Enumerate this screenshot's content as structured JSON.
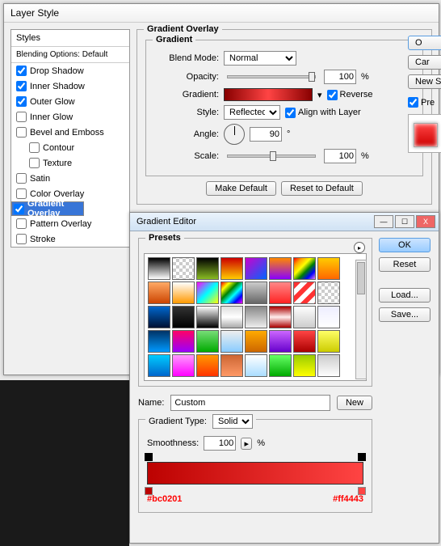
{
  "layerStyle": {
    "title": "Layer Style",
    "stylesHeader": "Styles",
    "blendingOptions": "Blending Options: Default",
    "items": [
      {
        "label": "Drop Shadow",
        "checked": true
      },
      {
        "label": "Inner Shadow",
        "checked": true
      },
      {
        "label": "Outer Glow",
        "checked": true
      },
      {
        "label": "Inner Glow",
        "checked": false
      },
      {
        "label": "Bevel and Emboss",
        "checked": false
      },
      {
        "label": "Contour",
        "checked": false,
        "sub": true
      },
      {
        "label": "Texture",
        "checked": false,
        "sub": true
      },
      {
        "label": "Satin",
        "checked": false
      },
      {
        "label": "Color Overlay",
        "checked": false
      },
      {
        "label": "Gradient Overlay",
        "checked": true,
        "selected": true
      },
      {
        "label": "Pattern Overlay",
        "checked": false
      },
      {
        "label": "Stroke",
        "checked": false
      }
    ],
    "panel": {
      "title": "Gradient Overlay",
      "subTitle": "Gradient",
      "blendModeLabel": "Blend Mode:",
      "blendMode": "Normal",
      "opacityLabel": "Opacity:",
      "opacity": "100",
      "pct": "%",
      "gradientLabel": "Gradient:",
      "reverseLabel": "Reverse",
      "reverse": true,
      "styleLabel": "Style:",
      "style": "Reflected",
      "alignLabel": "Align with Layer",
      "align": true,
      "angleLabel": "Angle:",
      "angle": "90",
      "deg": "°",
      "scaleLabel": "Scale:",
      "scale": "100",
      "makeDefault": "Make Default",
      "resetDefault": "Reset to Default"
    },
    "right": {
      "ok": "O",
      "cancel": "Car",
      "newStyle": "New S",
      "previewLabel": "Pre",
      "preview": true
    }
  },
  "gradientEditor": {
    "title": "Gradient Editor",
    "presetsLabel": "Presets",
    "ok": "OK",
    "reset": "Reset",
    "load": "Load...",
    "save": "Save...",
    "nameLabel": "Name:",
    "name": "Custom",
    "new": "New",
    "gradientTypeLabel": "Gradient Type:",
    "gradientType": "Solid",
    "smoothnessLabel": "Smoothness:",
    "smoothness": "100",
    "pct": "%",
    "hexLeft": "#bc0201",
    "hexRight": "#ff4443",
    "swatches": [
      "linear-gradient(#000,#fff)",
      "repeating-conic-gradient(#ccc 0 25%,#fff 0 50%) 0/8px 8px",
      "linear-gradient(#000,#8b2)",
      "linear-gradient(#c00,#fc0)",
      "linear-gradient(135deg,#c0c,#06f)",
      "linear-gradient(#f80,#80f)",
      "linear-gradient(135deg,red,orange,yellow,green,blue,violet)",
      "linear-gradient(#fc0,#f60)",
      "linear-gradient(#fa6,#c40)",
      "linear-gradient(#fff,#f90)",
      "linear-gradient(135deg,#f0f,#0ff,#ff0)",
      "linear-gradient(135deg,red,yellow,green,cyan,blue,magenta)",
      "linear-gradient(#ccc,#666)",
      "linear-gradient(#f88,#f22)",
      "repeating-linear-gradient(135deg,#f33 0 6px,#fff 6px 12px)",
      "repeating-conic-gradient(#ccc 0 25%,#fff 0 50%) 0/8px 8px",
      "linear-gradient(#06c,#013)",
      "linear-gradient(#333,#000)",
      "linear-gradient(#fff,#000)",
      "linear-gradient(#ddd,#fff,#aaa)",
      "linear-gradient(#888,#eee)",
      "linear-gradient(#a00,#fee,#a00)",
      "linear-gradient(#fff,#ccc)",
      "linear-gradient(#eef,#fff)",
      "linear-gradient(#036,#09f)",
      "linear-gradient(#f06,#90f)",
      "linear-gradient(#7d7,#0a0)",
      "linear-gradient(#eee,#8cf)",
      "linear-gradient(#fa0,#c60)",
      "linear-gradient(#c6f,#60c)",
      "linear-gradient(#f44,#a00)",
      "linear-gradient(#ff6,#cc0)",
      "linear-gradient(#0cf,#06c)",
      "linear-gradient(#f9f,#f0f)",
      "linear-gradient(#f90,#f30)",
      "linear-gradient(#c63,#f96)",
      "linear-gradient(#fff,#adf)",
      "linear-gradient(#6f6,#0a0)",
      "linear-gradient(#9c0,#ff0)",
      "linear-gradient(#ccc,#fff)"
    ]
  }
}
